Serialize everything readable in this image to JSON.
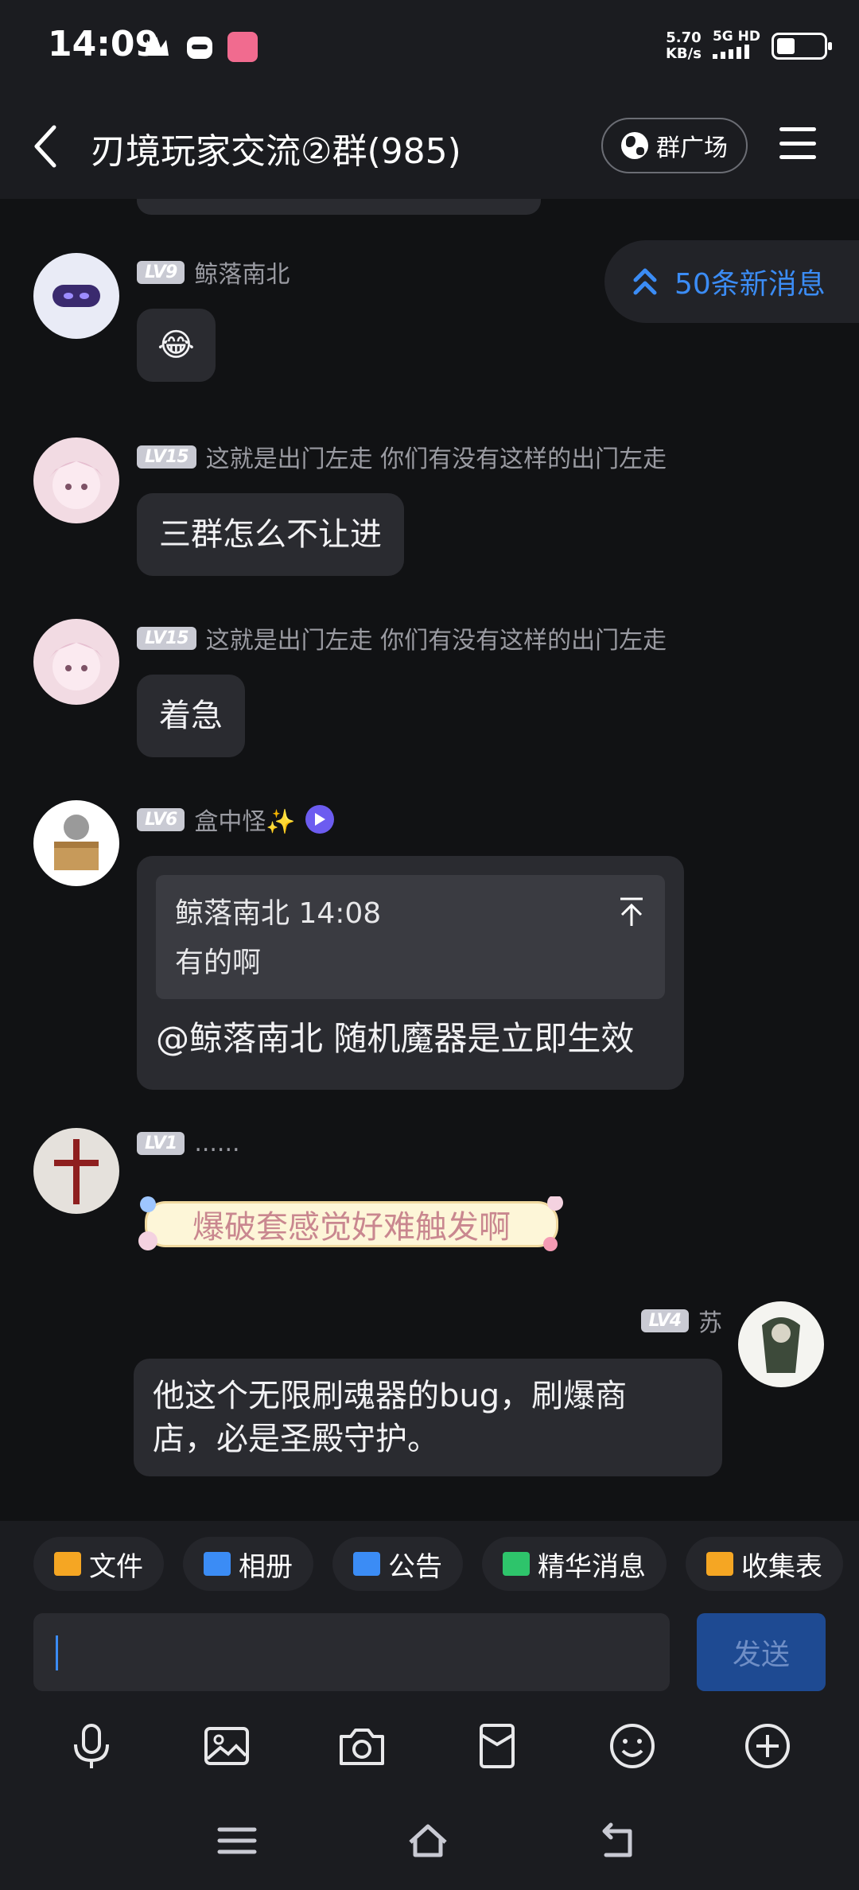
{
  "status_bar": {
    "time": "14:09",
    "speed_value": "5.70",
    "speed_unit": "KB/s",
    "network": "5G HD"
  },
  "header": {
    "title": "刃境玩家交流②群(985)",
    "plaza_label": "群广场"
  },
  "new_messages": {
    "label": "50条新消息"
  },
  "messages": [
    {
      "level": "LV9",
      "name": "鲸落南北",
      "content": "😂"
    },
    {
      "level": "LV15",
      "name": "这就是出门左走 你们有没有这样的出门左走",
      "content": "三群怎么不让进"
    },
    {
      "level": "LV15",
      "name": "这就是出门左走 你们有没有这样的出门左走",
      "content": "着急"
    },
    {
      "level": "LV6",
      "name": "盒中怪✨",
      "quote_header": "鲸落南北 14:08",
      "quote_text": "有的啊",
      "content": "@鲸落南北 随机魔器是立即生效"
    },
    {
      "level": "LV1",
      "name": "......",
      "content": "爆破套感觉好难触发啊"
    },
    {
      "level": "LV4",
      "name": "苏",
      "content_line1": "他这个无限刷魂器的bug，刷爆商",
      "content_line2": "店，必是圣殿守护。"
    }
  ],
  "shortcuts": [
    {
      "label": "文件",
      "color": "#f5a623"
    },
    {
      "label": "相册",
      "color": "#3b8cf5"
    },
    {
      "label": "公告",
      "color": "#3b8cf5"
    },
    {
      "label": "精华消息",
      "color": "#2ec46b"
    },
    {
      "label": "收集表",
      "color": "#f5a623"
    }
  ],
  "input": {
    "send_label": "发送"
  },
  "toolbar": [
    "microphone-icon",
    "image-icon",
    "camera-icon",
    "red-packet-icon",
    "emoji-icon",
    "plus-icon"
  ]
}
